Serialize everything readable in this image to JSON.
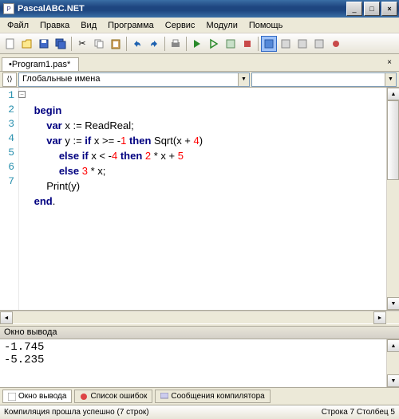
{
  "window": {
    "title": "PascalABC.NET",
    "btn_min": "_",
    "btn_max": "□",
    "btn_close": "×"
  },
  "menu": {
    "file": "Файл",
    "edit": "Правка",
    "view": "Вид",
    "program": "Программа",
    "service": "Сервис",
    "modules": "Модули",
    "help": "Помощь"
  },
  "tabs": {
    "program1": "•Program1.pas*",
    "close": "×"
  },
  "scope": {
    "icon": "⟨⟩",
    "label": "Глобальные имена",
    "dd": "▼"
  },
  "code": {
    "lines": [
      "1",
      "2",
      "3",
      "4",
      "5",
      "6",
      "7"
    ],
    "fold": "−",
    "l1_begin": "begin",
    "l2_var": "var",
    "l2_rest": " x := ReadReal;",
    "l3_var": "var",
    "l3_a": " y := ",
    "l3_if": "if",
    "l3_b": " x >= -",
    "l3_n1": "1",
    "l3_then": " then",
    "l3_c": " Sqrt(x + ",
    "l3_n4": "4",
    "l3_d": ")",
    "l4_else": "else",
    "l4_sp": " ",
    "l4_if": "if",
    "l4_a": " x < -",
    "l4_n4": "4",
    "l4_then": " then",
    "l4_b": " ",
    "l4_n2": "2",
    "l4_c": " * x + ",
    "l4_n5": "5",
    "l5_else": "else",
    "l5_a": " ",
    "l5_n3": "3",
    "l5_b": " * x;",
    "l6": "Print(y)",
    "l7_end": "end",
    "l7_dot": "."
  },
  "output": {
    "title": "Окно вывода",
    "text": "-1.745\n-5.235"
  },
  "bottom_tabs": {
    "out": "Окно вывода",
    "err": "Список ошибок",
    "msg": "Сообщения компилятора"
  },
  "status": {
    "left": "Компиляция прошла успешно (7 строк)",
    "right": "Строка  7 Столбец  5"
  }
}
